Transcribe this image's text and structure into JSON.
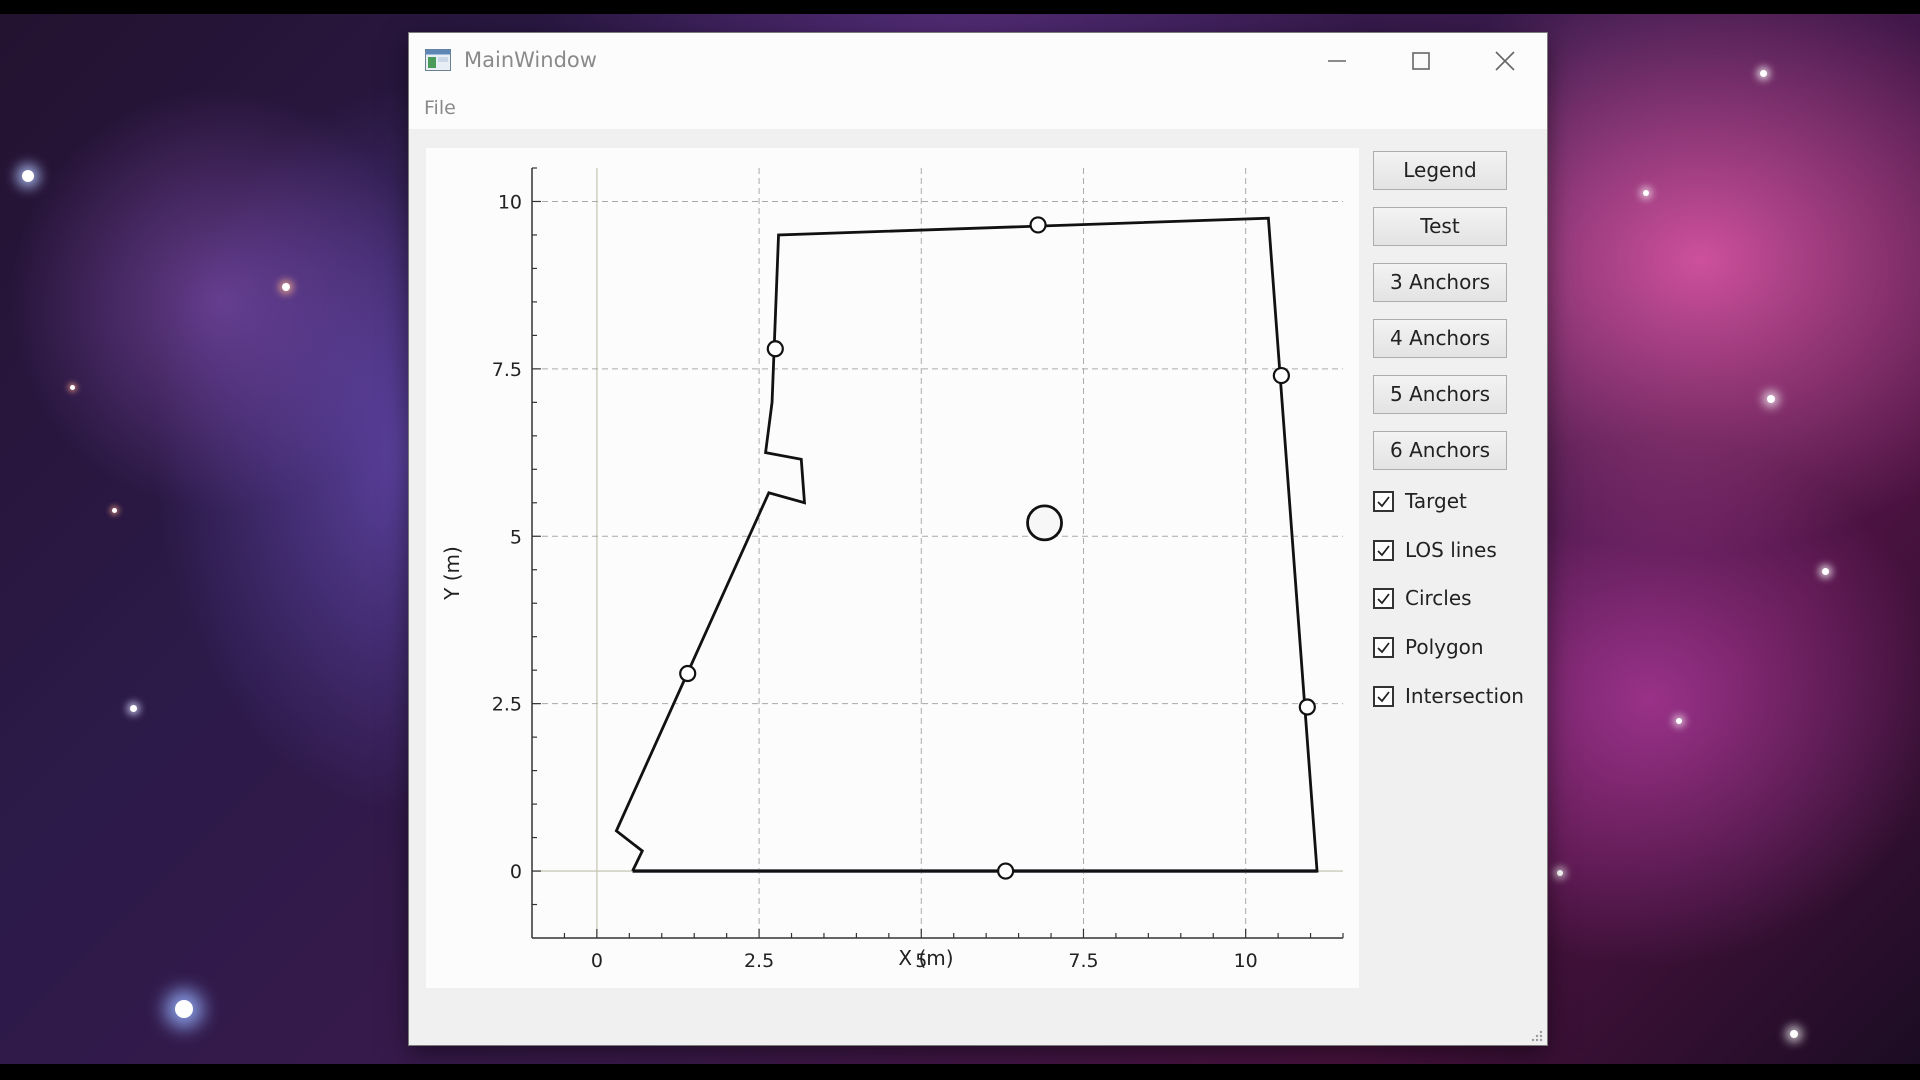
{
  "window": {
    "title": "MainWindow",
    "menu": {
      "file": "File"
    }
  },
  "sidebar": {
    "buttons": [
      {
        "label": "Legend"
      },
      {
        "label": "Test"
      },
      {
        "label": "3 Anchors"
      },
      {
        "label": "4 Anchors"
      },
      {
        "label": "5 Anchors"
      },
      {
        "label": "6 Anchors"
      }
    ],
    "checkboxes": [
      {
        "label": "Target",
        "checked": true
      },
      {
        "label": "LOS lines",
        "checked": true
      },
      {
        "label": "Circles",
        "checked": true
      },
      {
        "label": "Polygon",
        "checked": true
      },
      {
        "label": "Intersection",
        "checked": true
      }
    ]
  },
  "chart_data": {
    "type": "line",
    "xlabel": "X (m)",
    "ylabel": "Y (m)",
    "xlim": [
      -1,
      11.5
    ],
    "ylim": [
      -1,
      10.5
    ],
    "xticks": [
      0,
      2.5,
      5,
      7.5,
      10
    ],
    "xtick_labels": [
      "0",
      "2.5",
      "5",
      "7.5",
      "10"
    ],
    "yticks": [
      0,
      2.5,
      5,
      7.5,
      10
    ],
    "ytick_labels": [
      "0",
      "2.5",
      "5",
      "7.5",
      "10"
    ],
    "grid": true,
    "polygon": {
      "x": [
        0.55,
        11.1,
        10.35,
        2.8,
        2.7,
        2.6,
        3.15,
        3.2,
        2.65,
        0.3,
        0.7,
        0.55
      ],
      "y": [
        0,
        0,
        9.75,
        9.5,
        7.0,
        6.25,
        6.15,
        5.5,
        5.65,
        0.6,
        0.3,
        0
      ]
    },
    "anchors": {
      "x": [
        6.3,
        10.95,
        10.55,
        6.8,
        2.75,
        1.4
      ],
      "y": [
        0,
        2.45,
        7.4,
        9.65,
        7.8,
        2.95
      ]
    },
    "target": {
      "x": 6.9,
      "y": 5.2
    },
    "colors": {
      "line": "#111111",
      "grid": "#aaaaaa",
      "axis": "#333333"
    }
  }
}
